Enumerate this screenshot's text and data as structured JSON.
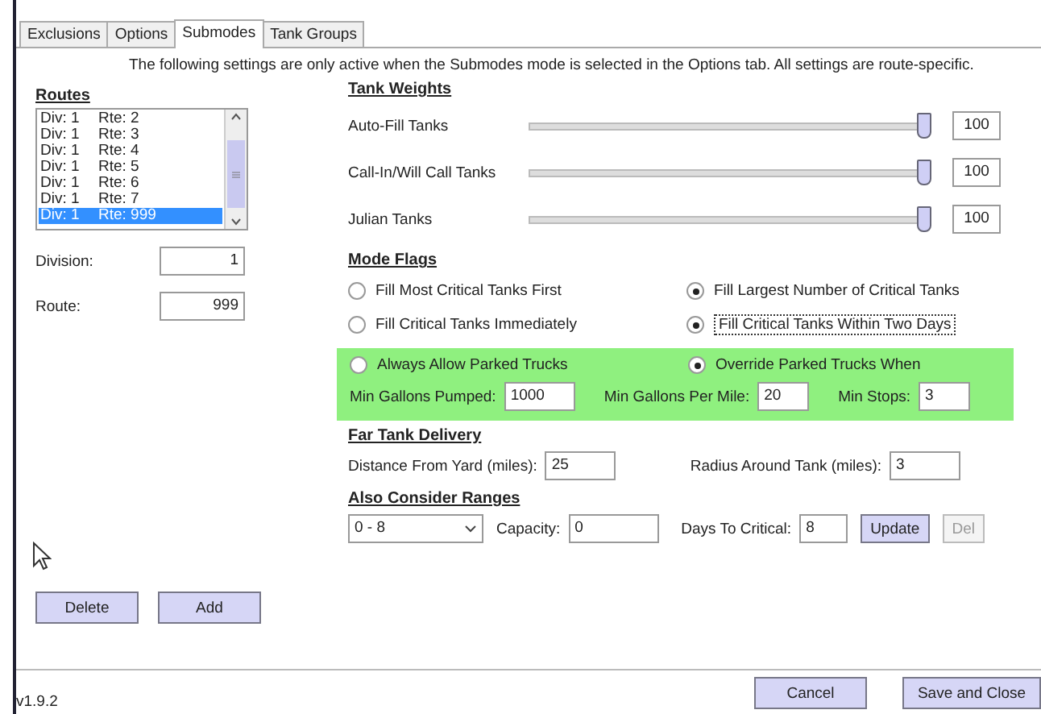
{
  "tabs": [
    {
      "label": "Exclusions",
      "selected": false
    },
    {
      "label": "Options",
      "selected": false
    },
    {
      "label": "Submodes",
      "selected": true
    },
    {
      "label": "Tank Groups",
      "selected": false
    }
  ],
  "notice": "The following settings are only active when the Submodes mode is selected in the Options tab.  All settings are route-specific.",
  "routes": {
    "title": "Routes",
    "items": [
      {
        "div": "Div: 1",
        "rte": "Rte: 2",
        "selected": false
      },
      {
        "div": "Div: 1",
        "rte": "Rte: 3",
        "selected": false
      },
      {
        "div": "Div: 1",
        "rte": "Rte: 4",
        "selected": false
      },
      {
        "div": "Div: 1",
        "rte": "Rte: 5",
        "selected": false
      },
      {
        "div": "Div: 1",
        "rte": "Rte: 6",
        "selected": false
      },
      {
        "div": "Div: 1",
        "rte": "Rte: 7",
        "selected": false
      },
      {
        "div": "Div: 1",
        "rte": "Rte: 999",
        "selected": true
      }
    ],
    "fields": [
      {
        "label": "Division:",
        "value": "1"
      },
      {
        "label": "Route:",
        "value": "999"
      }
    ],
    "buttons": [
      "Delete",
      "Add"
    ]
  },
  "tank_weights": {
    "title": "Tank Weights",
    "rows": [
      {
        "label": "Auto-Fill Tanks",
        "level": 1,
        "value": "100"
      },
      {
        "label": "Call-In/Will Call Tanks",
        "level": 1,
        "value": "100"
      },
      {
        "label": "Julian Tanks",
        "level": 1,
        "value": "100"
      }
    ]
  },
  "mode_flags": {
    "title": "Mode Flags",
    "options": [
      {
        "label": "Fill Most Critical Tanks First",
        "selected": false,
        "focused": false
      },
      {
        "label": "Fill Largest Number of Critical Tanks",
        "selected": true,
        "focused": false
      },
      {
        "label": "Fill Critical Tanks Immediately",
        "selected": false,
        "focused": false
      },
      {
        "label": "Fill Critical Tanks Within Two Days",
        "selected": true,
        "focused": true
      }
    ],
    "parked": {
      "options": [
        {
          "label": "Always Allow Parked Trucks",
          "selected": false
        },
        {
          "label": "Override Parked Trucks When",
          "selected": true
        }
      ],
      "fields": [
        {
          "label": "Min Gallons Pumped:",
          "value": "1000"
        },
        {
          "label": "Min Gallons Per Mile:",
          "value": "20"
        },
        {
          "label": "Min Stops:",
          "value": "3"
        }
      ]
    }
  },
  "far_tank_delivery": {
    "title": "Far Tank Delivery",
    "fields": [
      {
        "label": "Distance From Yard (miles):",
        "value": "25"
      },
      {
        "label": "Radius Around Tank (miles):",
        "value": "3"
      }
    ]
  },
  "also_consider_ranges": {
    "title": "Also Consider Ranges",
    "range": "0 - 8",
    "fields": [
      {
        "label": "Capacity:",
        "value": "0"
      },
      {
        "label": "Days To Critical:",
        "value": "8"
      }
    ],
    "buttons": [
      {
        "label": "Update",
        "disabled": false
      },
      {
        "label": "Del",
        "disabled": true
      }
    ]
  },
  "version": "v1.9.2",
  "footer_buttons": [
    "Cancel",
    "Save and Close"
  ]
}
